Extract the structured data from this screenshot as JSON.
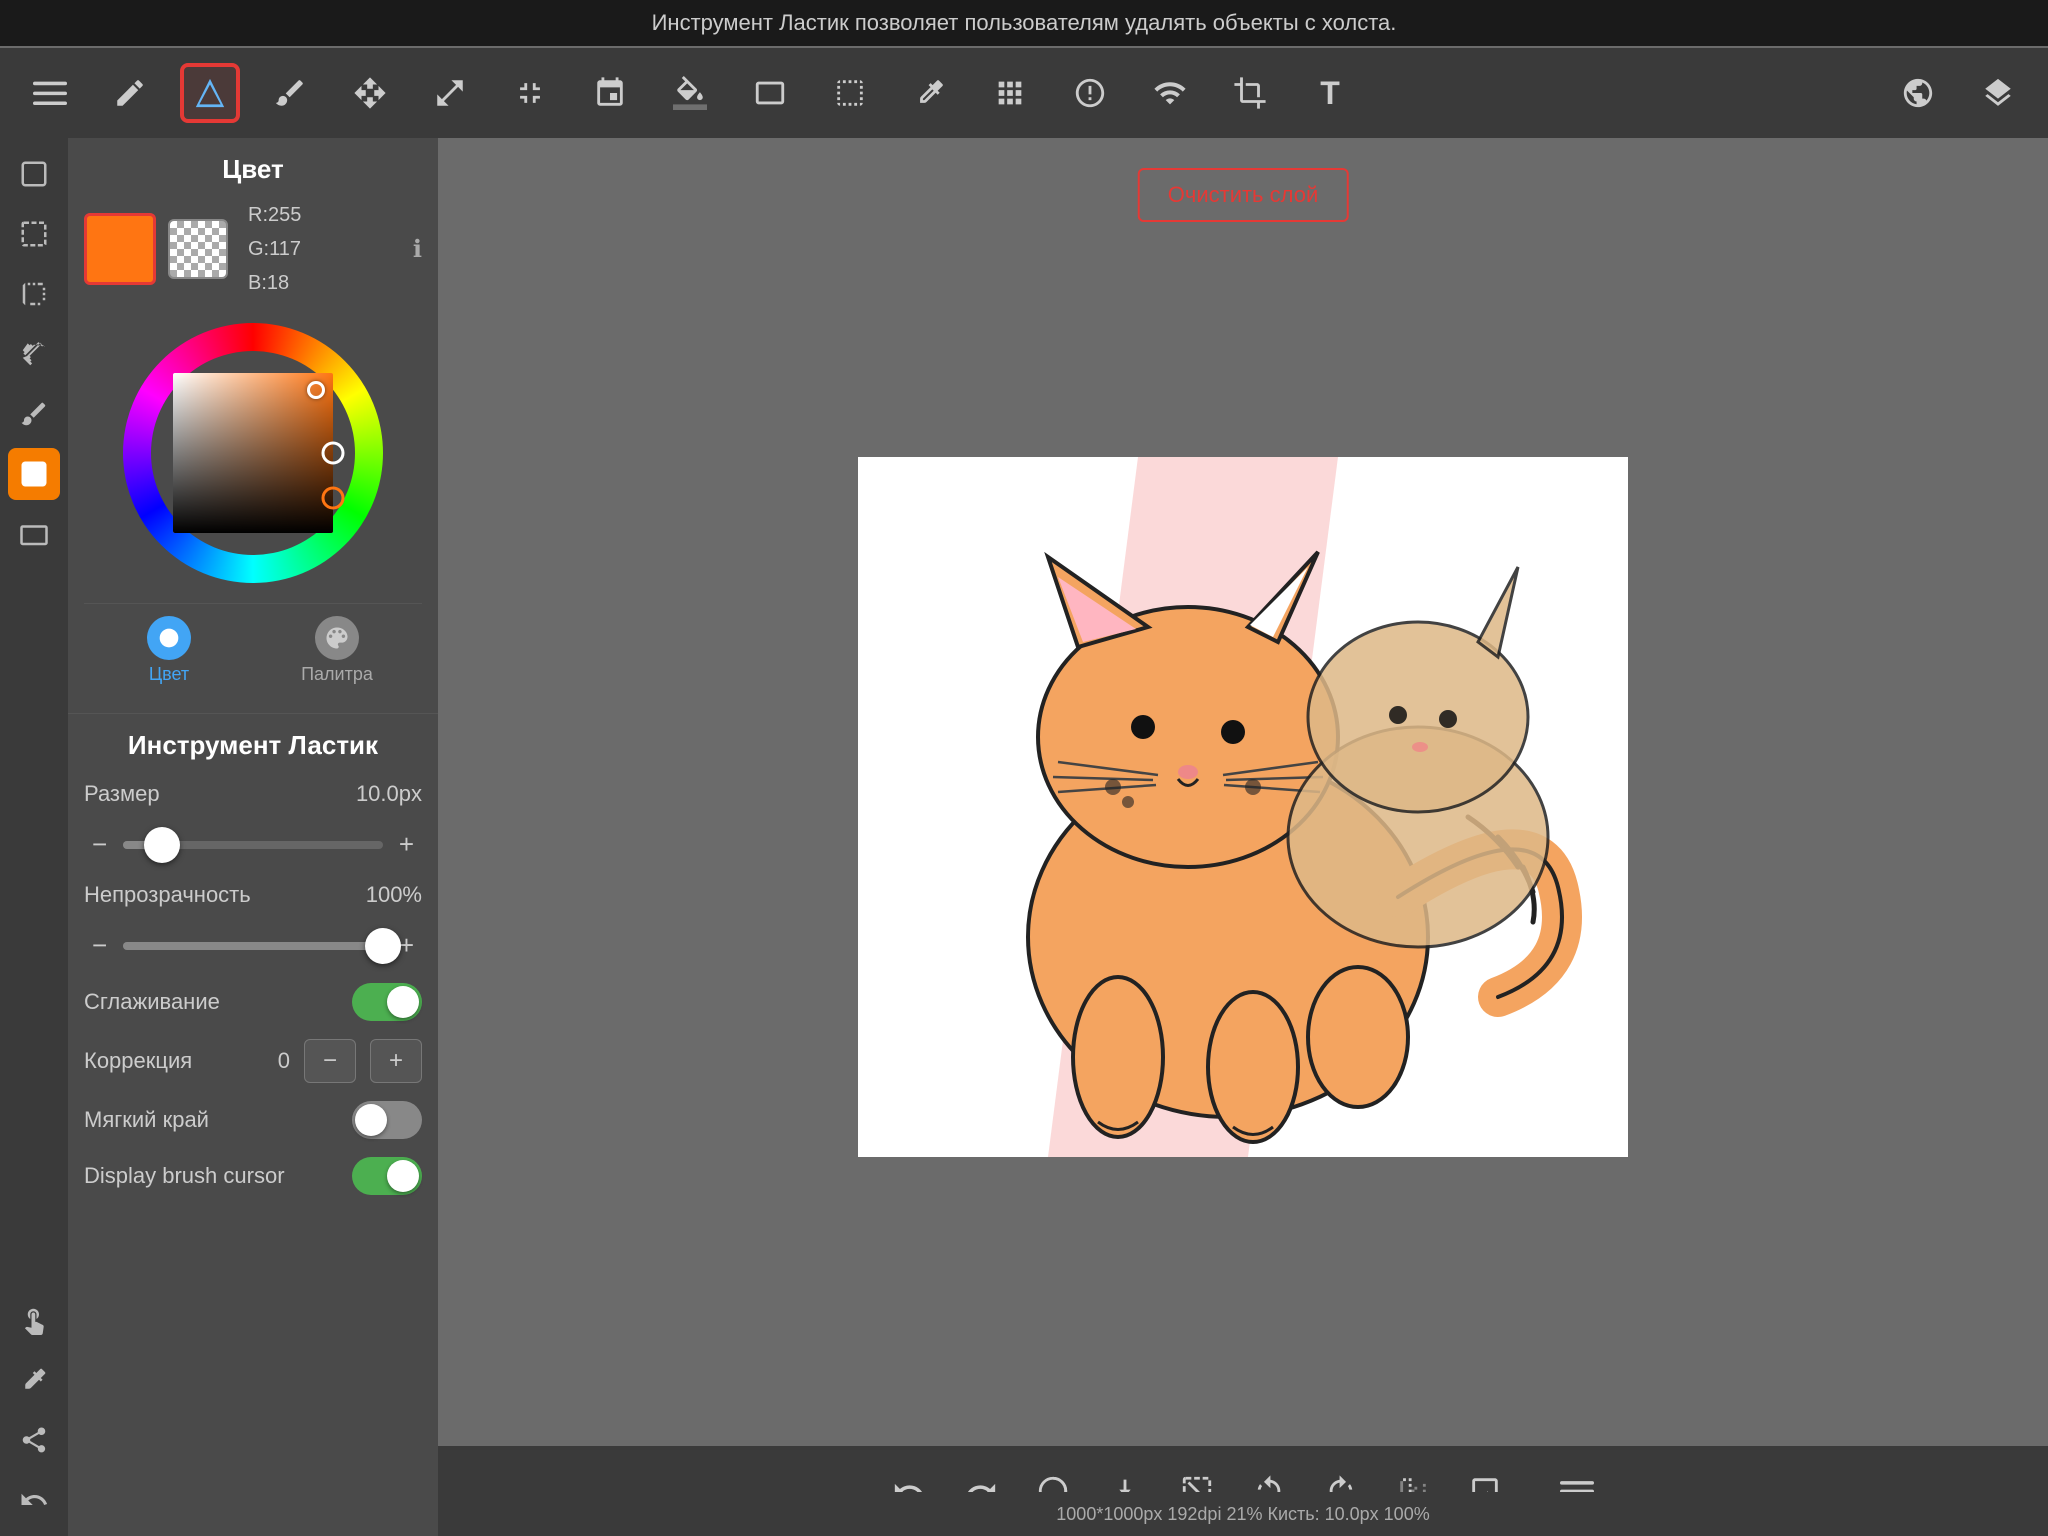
{
  "topBar": {
    "text": "Инструмент Ластик позволяет пользователям удалять объекты с холста."
  },
  "toolbar": {
    "tools": [
      {
        "name": "menu",
        "icon": "☰",
        "label": "menu-icon"
      },
      {
        "name": "pencil",
        "icon": "✏",
        "label": "pencil-icon"
      },
      {
        "name": "eraser",
        "icon": "◆",
        "label": "eraser-icon",
        "active": true
      },
      {
        "name": "smudge",
        "icon": "✦",
        "label": "smudge-icon"
      },
      {
        "name": "move",
        "icon": "✛",
        "label": "move-icon"
      },
      {
        "name": "resize-up",
        "icon": "⬔",
        "label": "resize-up-icon"
      },
      {
        "name": "resize-down",
        "icon": "⬕",
        "label": "resize-down-icon"
      },
      {
        "name": "lasso",
        "icon": "⬡",
        "label": "lasso-icon"
      },
      {
        "name": "fill",
        "icon": "⬢",
        "label": "fill-icon"
      },
      {
        "name": "rectangle",
        "icon": "▭",
        "label": "rectangle-icon"
      },
      {
        "name": "selection",
        "icon": "⬚",
        "label": "selection-icon"
      },
      {
        "name": "eyedropper",
        "icon": "💉",
        "label": "eyedropper-icon"
      },
      {
        "name": "brush-adjust",
        "icon": "⬙",
        "label": "brush-adjust-icon"
      },
      {
        "name": "transform",
        "icon": "◇",
        "label": "transform-icon"
      },
      {
        "name": "layers-group",
        "icon": "⊞",
        "label": "layers-group-icon"
      },
      {
        "name": "crop",
        "icon": "⌗",
        "label": "crop-icon"
      },
      {
        "name": "text",
        "icon": "T",
        "label": "text-icon"
      },
      {
        "name": "globe",
        "icon": "🌐",
        "label": "globe-icon"
      },
      {
        "name": "layers",
        "icon": "⊕",
        "label": "layers-icon"
      }
    ]
  },
  "leftSidebar": {
    "icons": [
      {
        "name": "canvas",
        "icon": "⬜",
        "label": "canvas-icon"
      },
      {
        "name": "selection-sidebar",
        "icon": "⬚",
        "label": "selection-sidebar-icon"
      },
      {
        "name": "flip",
        "icon": "↔",
        "label": "flip-icon"
      },
      {
        "name": "ruler",
        "icon": "⊢",
        "label": "ruler-icon"
      },
      {
        "name": "brush-tool",
        "icon": "✏",
        "label": "brush-tool-icon"
      },
      {
        "name": "color-active",
        "icon": "⬛",
        "label": "color-active-icon",
        "active": true
      },
      {
        "name": "layer-sidebar",
        "icon": "▭",
        "label": "layer-sidebar-icon"
      },
      {
        "name": "hand",
        "icon": "✋",
        "label": "hand-icon"
      },
      {
        "name": "eyedropper-sidebar",
        "icon": "✦",
        "label": "eyedropper-sidebar-icon"
      },
      {
        "name": "share",
        "icon": "↪",
        "label": "share-icon"
      },
      {
        "name": "undo-sidebar",
        "icon": "↩",
        "label": "undo-sidebar-icon"
      }
    ]
  },
  "colorPanel": {
    "title": "Цвет",
    "primaryColor": "#ff7512",
    "rgbValues": {
      "r": "R:255",
      "g": "G:117",
      "b": "B:18"
    },
    "tabs": [
      {
        "id": "color",
        "label": "Цвет",
        "active": true
      },
      {
        "id": "palette",
        "label": "Палитра",
        "active": false
      }
    ]
  },
  "toolSettings": {
    "title": "Инструмент Ластик",
    "size": {
      "label": "Размер",
      "value": "10.0px",
      "sliderPercent": 15
    },
    "opacity": {
      "label": "Непрозрачность",
      "value": "100%",
      "sliderPercent": 100
    },
    "smoothing": {
      "label": "Сглаживание",
      "enabled": true
    },
    "correction": {
      "label": "Коррекция",
      "value": "0"
    },
    "softEdge": {
      "label": "Мягкий край",
      "enabled": false
    },
    "displayCursor": {
      "label": "Display brush cursor",
      "enabled": true
    }
  },
  "clearLayerButton": "Очистить слой",
  "bottomBar": {
    "icons": [
      {
        "name": "undo",
        "icon": "↩",
        "label": "undo-icon"
      },
      {
        "name": "redo",
        "icon": "↪",
        "label": "redo-icon"
      },
      {
        "name": "transform-b",
        "icon": "⟳",
        "label": "transform-b-icon"
      },
      {
        "name": "download",
        "icon": "⬇",
        "label": "download-icon"
      },
      {
        "name": "deselect",
        "icon": "⬚",
        "label": "deselect-icon"
      },
      {
        "name": "rotate-ccw",
        "icon": "↺",
        "label": "rotate-ccw-icon"
      },
      {
        "name": "rotate-cw",
        "icon": "↻",
        "label": "rotate-cw-icon"
      },
      {
        "name": "flip-h",
        "icon": "⇌",
        "label": "flip-h-icon"
      },
      {
        "name": "image",
        "icon": "▣",
        "label": "image-icon"
      },
      {
        "name": "menu-bottom",
        "icon": "≡",
        "label": "menu-bottom-icon"
      }
    ]
  },
  "statusBar": {
    "text": "1000*1000px 192dpi 21% Кисть: 10.0px 100%"
  }
}
